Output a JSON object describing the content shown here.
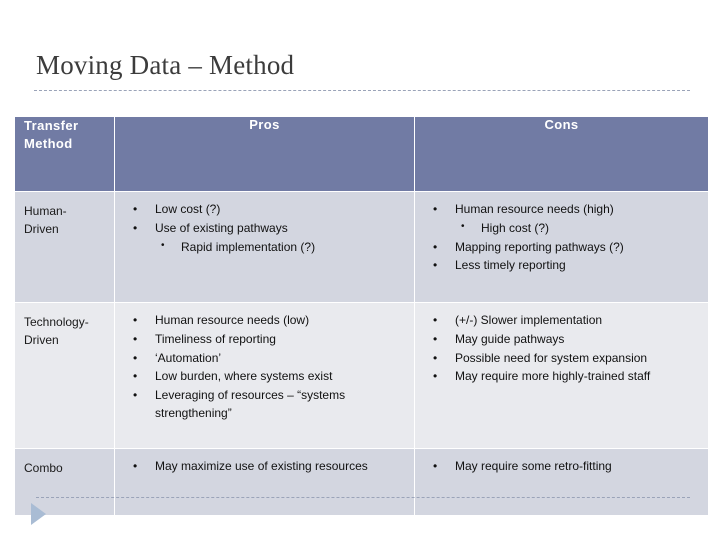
{
  "slide": {
    "title": "Moving Data – Method",
    "accent_color": "#717ba4",
    "row_shaded_color": "#d3d6e0",
    "row_light_color": "#e9eaee",
    "rule_color": "#9aa3b8",
    "triangle_color": "#a9bcd4"
  },
  "table": {
    "headers": {
      "method": "Transfer\nMethod",
      "method_line1": "Transfer",
      "method_line2": "Method",
      "pros": "Pros",
      "cons": "Cons"
    },
    "rows": [
      {
        "method": "Human-\nDriven",
        "method_line1": "Human-",
        "method_line2": "Driven",
        "pros": [
          {
            "text": "Low cost (?)",
            "level": 1
          },
          {
            "text": "Use of existing pathways",
            "level": 1
          },
          {
            "text": "Rapid implementation (?)",
            "level": 2
          }
        ],
        "cons": [
          {
            "text": "Human resource needs (high)",
            "level": 1
          },
          {
            "text": "High cost (?)",
            "level": 2
          },
          {
            "text": "Mapping reporting pathways (?)",
            "level": 1
          },
          {
            "text": "Less timely reporting",
            "level": 1
          }
        ]
      },
      {
        "method": "Technology-\nDriven",
        "method_line1": "Technology-",
        "method_line2": "Driven",
        "pros": [
          {
            "text": "Human resource needs (low)",
            "level": 1
          },
          {
            "text": "Timeliness of reporting",
            "level": 1
          },
          {
            "text": "‘Automation’",
            "level": 1
          },
          {
            "text": "Low burden, where systems exist",
            "level": 1
          },
          {
            "text": "Leveraging of resources – “systems strengthening”",
            "level": 1
          }
        ],
        "cons": [
          {
            "text": "(+/-) Slower implementation",
            "level": 1
          },
          {
            "text": "May guide pathways",
            "level": 1
          },
          {
            "text": "Possible need for system expansion",
            "level": 1
          },
          {
            "text": "May require more highly-trained staff",
            "level": 1
          }
        ]
      },
      {
        "method": "Combo",
        "method_line1": "Combo",
        "method_line2": "",
        "pros": [
          {
            "text": "May maximize use of existing resources",
            "level": 1
          }
        ],
        "cons": [
          {
            "text": "May require some retro-fitting",
            "level": 1
          }
        ]
      }
    ]
  },
  "footer": {
    "decoration_icon": "play-triangle-icon"
  }
}
